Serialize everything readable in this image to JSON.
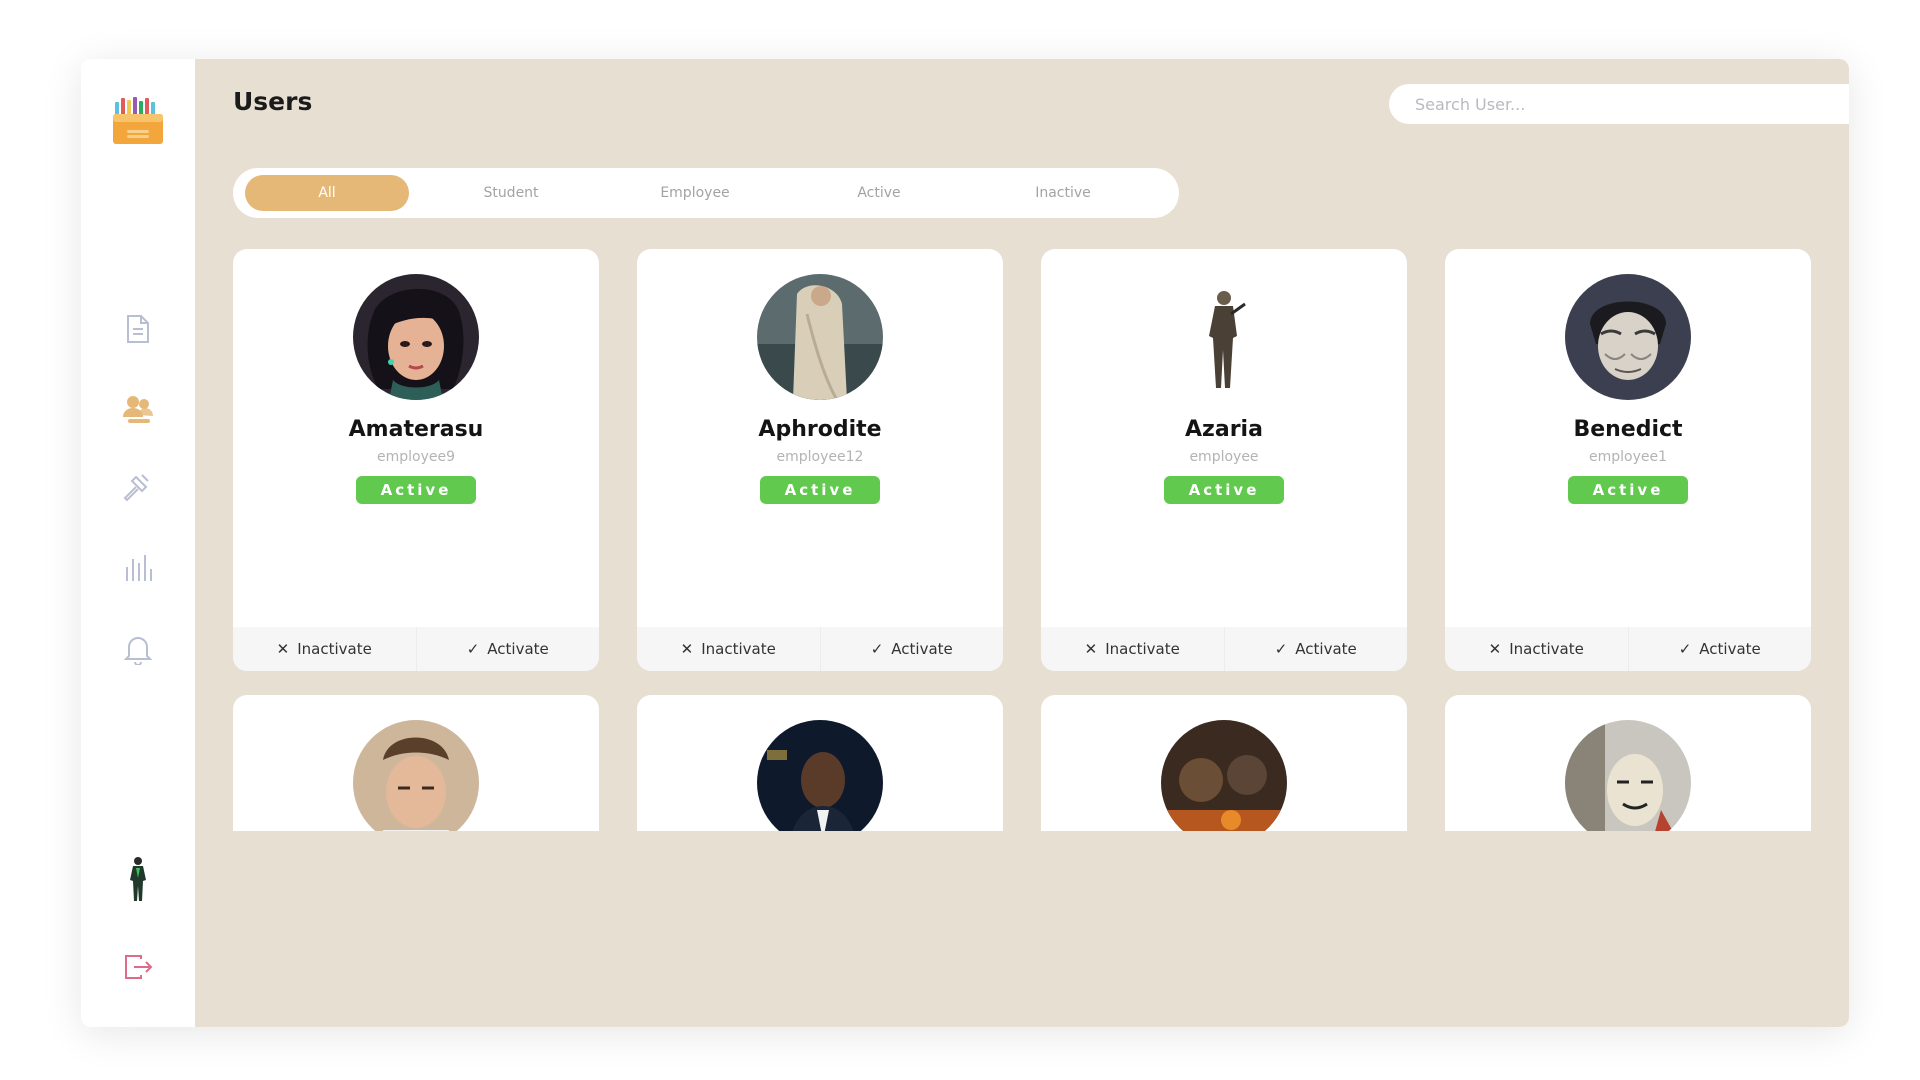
{
  "page_title": "Users",
  "search": {
    "placeholder": "Search User..."
  },
  "tabs": [
    {
      "label": "All",
      "active": true
    },
    {
      "label": "Student",
      "active": false
    },
    {
      "label": "Employee",
      "active": false
    },
    {
      "label": "Active",
      "active": false
    },
    {
      "label": "Inactive",
      "active": false
    }
  ],
  "sidebar": {
    "icons": [
      "document-icon",
      "users-icon",
      "hammer-icon",
      "bar-chart-icon",
      "bell-icon"
    ],
    "active_icon": "users-icon",
    "bottom": [
      "profile-avatar",
      "logout-icon"
    ]
  },
  "actions": {
    "inactivate_label": "Inactivate",
    "activate_label": "Activate"
  },
  "users": [
    {
      "name": "Amaterasu",
      "role": "employee9",
      "status": "Active"
    },
    {
      "name": "Aphrodite",
      "role": "employee12",
      "status": "Active"
    },
    {
      "name": "Azaria",
      "role": "employee",
      "status": "Active"
    },
    {
      "name": "Benedict",
      "role": "employee1",
      "status": "Active"
    },
    {
      "name": "",
      "role": "",
      "status": ""
    },
    {
      "name": "",
      "role": "",
      "status": ""
    },
    {
      "name": "",
      "role": "",
      "status": ""
    },
    {
      "name": "",
      "role": "",
      "status": ""
    }
  ],
  "colors": {
    "accent": "#e5b877",
    "active_status": "#62c94f",
    "background": "#e7dfd2",
    "logout": "#e06a8a",
    "nav_active": "#e5b877",
    "nav_inactive": "#b9bfd3"
  }
}
